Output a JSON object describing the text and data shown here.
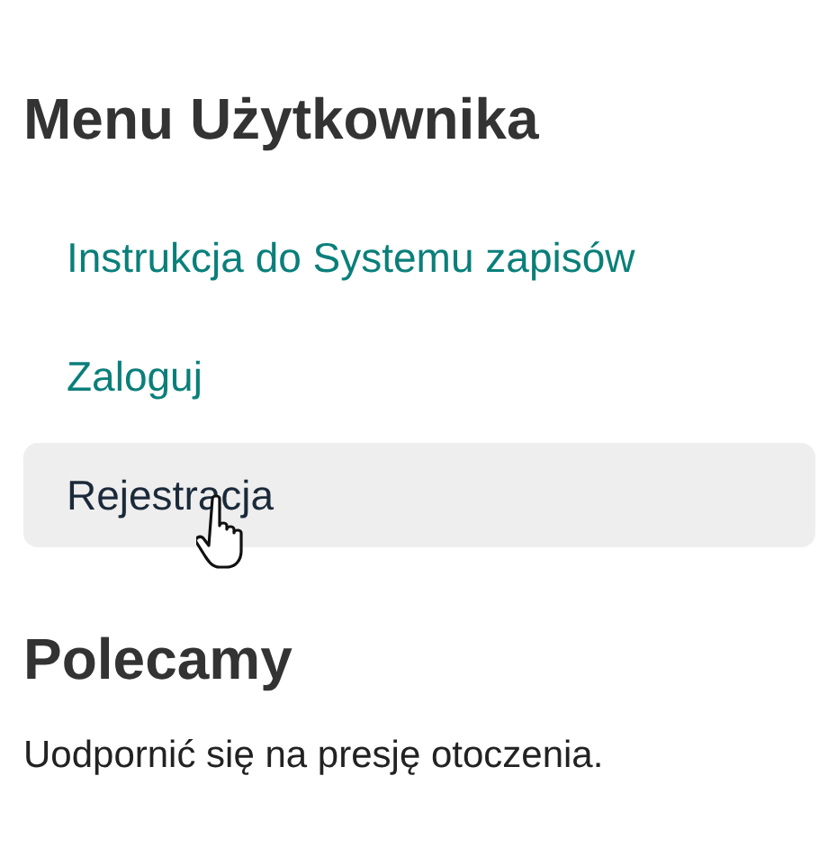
{
  "user_menu": {
    "title": "Menu Użytkownika",
    "items": [
      {
        "label": "Instrukcja do Systemu zapisów",
        "hovered": false
      },
      {
        "label": "Zaloguj",
        "hovered": false
      },
      {
        "label": "Rejestracja",
        "hovered": true
      }
    ]
  },
  "recommended": {
    "title": "Polecamy",
    "text": "Uodpornić się na presję otoczenia."
  }
}
